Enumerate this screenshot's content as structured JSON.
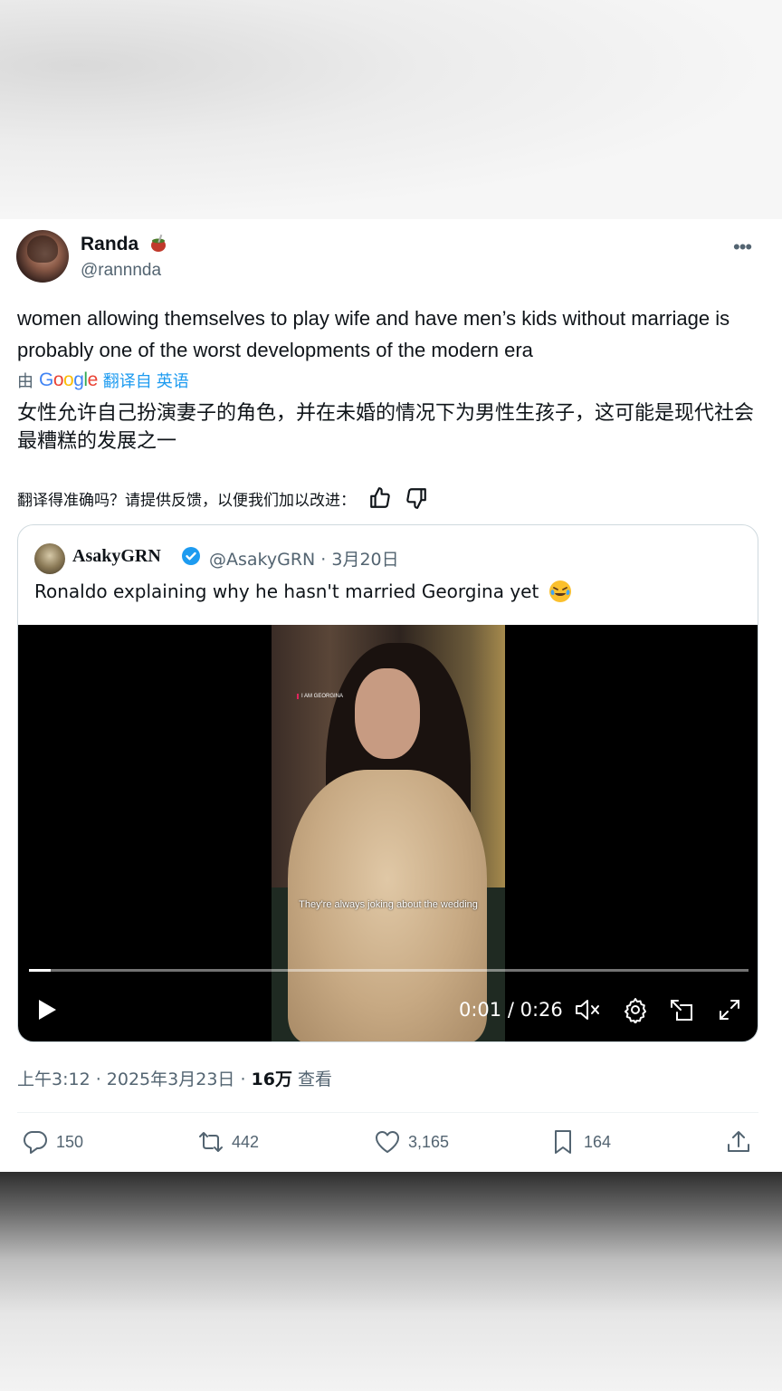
{
  "tweet": {
    "author_name": "Randa",
    "author_handle": "@rannnda",
    "text": "women allowing themselves to play wife and have men’s kids without marriage is probably one of the worst developments of the modern era",
    "translate_prefix": "由",
    "translate_link": "翻译自 英语",
    "translated_text": "女性允许自己扮演妻子的角色，并在未婚的情况下为男性生孩子，这可能是现代社会最糟糕的发展之一",
    "feedback_prompt": "翻译得准确吗？请提供反馈，以便我们加以改进：",
    "meta_time": "上午3:12 · 2025年3月23日 · ",
    "meta_views_count": "16万",
    "meta_views_label": " 查看"
  },
  "quote": {
    "author_name": "AsakyGRN",
    "author_handle": "@AsakyGRN · 3月20日",
    "text": "Ronaldo explaining why he hasn't married Georgina yet",
    "video": {
      "overlay_tag": "I AM GEORGINA",
      "subtitle": "They're always joking about the wedding",
      "time": "0:01 / 0:26",
      "progress_fraction": 0.03
    }
  },
  "actions": {
    "reply_count": "150",
    "retweet_count": "442",
    "like_count": "3,165",
    "bookmark_count": "164"
  },
  "colors": {
    "link": "#1d9bf0",
    "secondary_text": "#536471",
    "verified": "#1d9bf0"
  }
}
